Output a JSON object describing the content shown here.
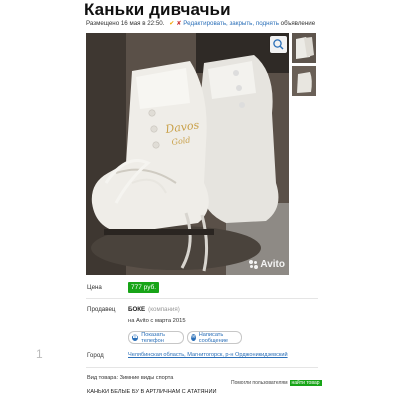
{
  "listing": {
    "title": "Каньки дивчачьи",
    "posted": "Размещено 16 мая в 22:50.",
    "edit_link": "Редактировать, закрыть, поднять",
    "edit_suffix": "объявление"
  },
  "photo": {
    "main_alt": "Белые фигурные коньки Davos Gold",
    "brand_line1": "Davos",
    "brand_line2": "Gold",
    "watermark": "Avito",
    "zoom_icon": "magnifier-icon"
  },
  "details": {
    "price_label": "Цена",
    "price_value": "777 руб.",
    "seller_label": "Продавец",
    "seller_name": "БОКЕ",
    "seller_company": "(компания)",
    "seller_since": "на Avito с марта 2015",
    "phone_button": "Показать телефон",
    "message_button": "Написать сообщение",
    "city_label": "Город",
    "city_value": "Челябинская область, Магнитогорск, р-н Орджоникидзевский",
    "category": "Вид товара: Зимние виды спорта",
    "description": "КАНЬКИ БЕЛЫЕ БУ В АРТЛИЧНАМ С АТАТЯНИИ"
  },
  "promo": {
    "text": "Помогли пользователям",
    "badge": "найти товар"
  },
  "margin_number": "1",
  "colors": {
    "price_badge": "#17a417",
    "link": "#2a6fb8"
  }
}
